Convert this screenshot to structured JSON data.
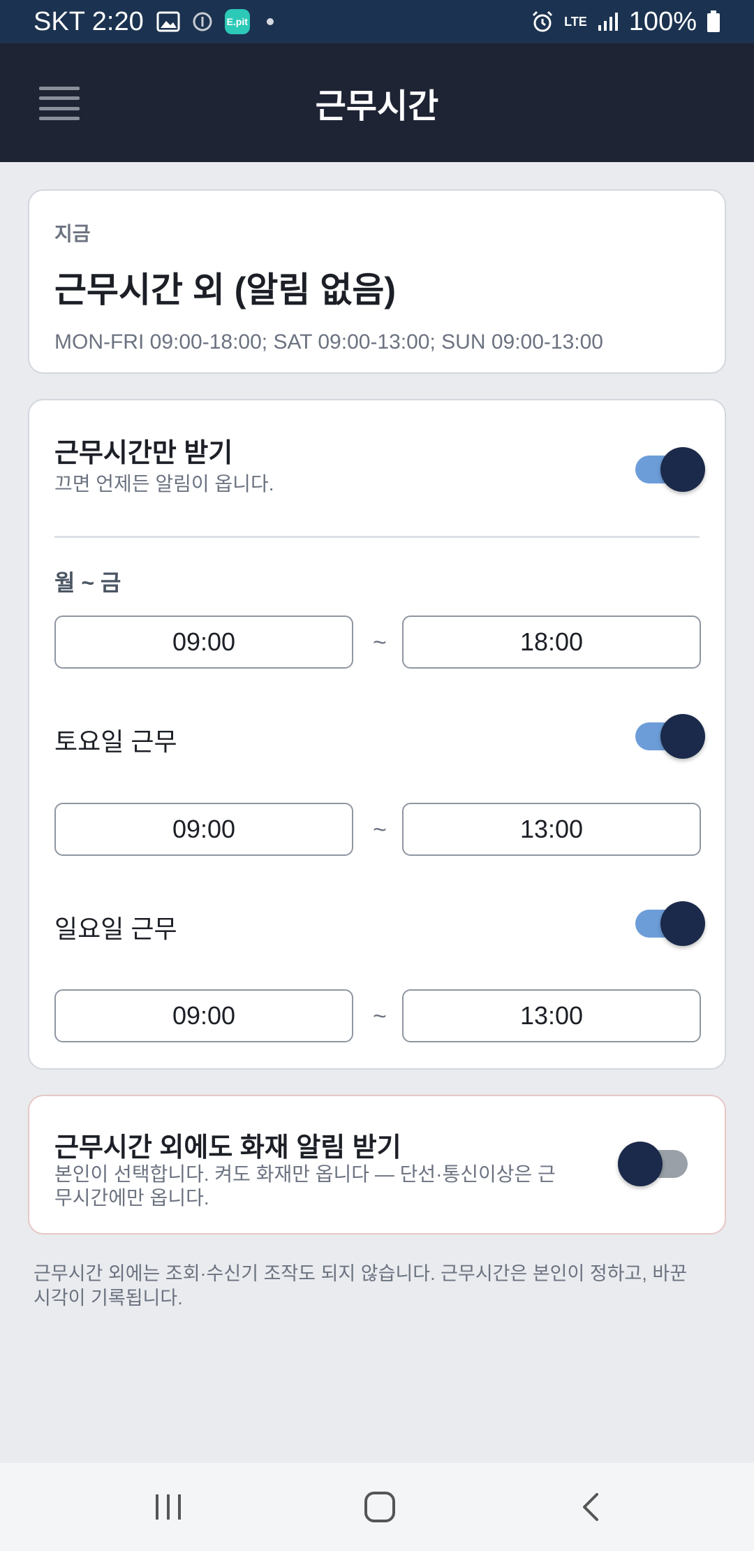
{
  "status_bar": {
    "carrier_time": "SKT 2:20",
    "app_badge": "E.pit",
    "network": "LTE",
    "battery": "100%",
    "icons": [
      "image-icon",
      "info-icon",
      "epit-app-icon",
      "notification-dot-icon",
      "alarm-icon",
      "lte-icon",
      "signal-icon",
      "battery-icon"
    ]
  },
  "header": {
    "title": "근무시간",
    "menu_icon": "hamburger-menu-icon"
  },
  "now_card": {
    "label": "지금",
    "status": "근무시간 외 (알림 없음)",
    "schedule": "MON-FRI 09:00-18:00; SAT 09:00-13:00; SUN 09:00-13:00"
  },
  "settings": {
    "work_hours_only": {
      "title": "근무시간만 받기",
      "subtitle": "끄면 언제든 알림이 옵니다.",
      "enabled": true
    },
    "weekdays": {
      "label": "월 ~ 금",
      "start": "09:00",
      "end": "18:00",
      "separator": "~"
    },
    "saturday": {
      "label": "토요일 근무",
      "enabled": true,
      "start": "09:00",
      "end": "13:00",
      "separator": "~"
    },
    "sunday": {
      "label": "일요일 근무",
      "enabled": true,
      "start": "09:00",
      "end": "13:00",
      "separator": "~"
    }
  },
  "fire_alert": {
    "title": "근무시간 외에도 화재 알림 받기",
    "subtitle": "본인이 선택합니다. 켜도 화재만 옵니다 — 단선·통신이상은 근무시간에만 옵니다.",
    "enabled": false
  },
  "footnote": "근무시간 외에는 조회·수신기 조작도 되지 않습니다. 근무시간은 본인이 정하고, 바꾼 시각이 기록됩니다.",
  "colors": {
    "status_bar": "#1b3350",
    "header": "#1e2433",
    "background": "#e9ebee",
    "toggle_on_track": "#6c9dd8",
    "toggle_thumb": "#1b2a4a",
    "toggle_off_track": "#9aa0a8"
  },
  "nav_bar": {
    "icons": [
      "recent-apps-icon",
      "home-icon",
      "back-icon"
    ]
  }
}
